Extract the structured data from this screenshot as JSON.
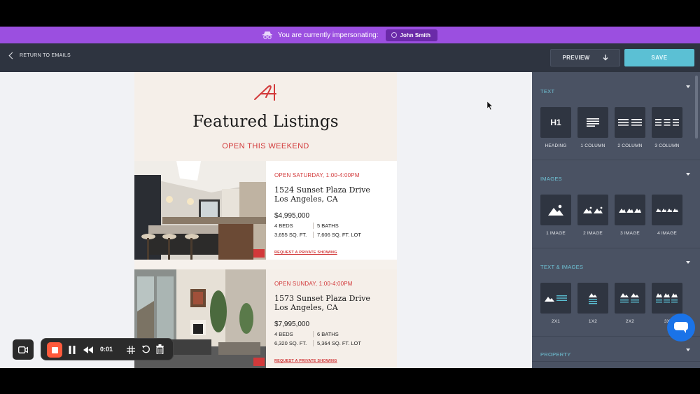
{
  "banner": {
    "text": "You are currently impersonating:",
    "user": "John Smith"
  },
  "topbar": {
    "back_label": "RETURN TO EMAILS",
    "preview_label": "PREVIEW",
    "save_label": "SAVE"
  },
  "email": {
    "headline": "Featured Listings",
    "subhead": "OPEN THIS WEEKEND",
    "listings": [
      {
        "open": "OPEN SATURDAY, 1:00-4:00PM",
        "addr1": "1524 Sunset Plaza Drive",
        "addr2": "Los Angeles, CA",
        "price": "$4,995,000",
        "beds": "4 BEDS",
        "baths": "5 BATHS",
        "sqft": "3,655 SQ. FT.",
        "lot": "7,606 SQ. FT. LOT",
        "cta": "REQUEST A PRIVATE SHOWING"
      },
      {
        "open": "OPEN SUNDAY, 1:00-4:00PM",
        "addr1": "1573 Sunset Plaza Drive",
        "addr2": "Los Angeles, CA",
        "price": "$7,995,000",
        "beds": "4 BEDS",
        "baths": "6 BATHS",
        "sqft": "6,320 SQ. FT.",
        "lot": "5,364 SQ. FT. LOT",
        "cta": "REQUEST A PRIVATE SHOWING"
      }
    ]
  },
  "panel": {
    "sections": [
      {
        "title": "TEXT",
        "items": [
          "HEADING",
          "1 COLUMN",
          "2 COLUMN",
          "3 COLUMN"
        ],
        "heading_glyph": "H1"
      },
      {
        "title": "IMAGES",
        "items": [
          "1 IMAGE",
          "2 IMAGE",
          "3 IMAGE",
          "4 IMAGE"
        ]
      },
      {
        "title": "TEXT & IMAGES",
        "items": [
          "2X1",
          "1X2",
          "2X2",
          "3X"
        ]
      },
      {
        "title": "PROPERTY"
      }
    ]
  },
  "recorder": {
    "time": "0:01"
  },
  "colors": {
    "banner": "#9b4fe0",
    "accent": "#5bc0d4",
    "brand_red": "#d2393a",
    "panel": "#4a5263",
    "topbar": "#2e3440"
  }
}
